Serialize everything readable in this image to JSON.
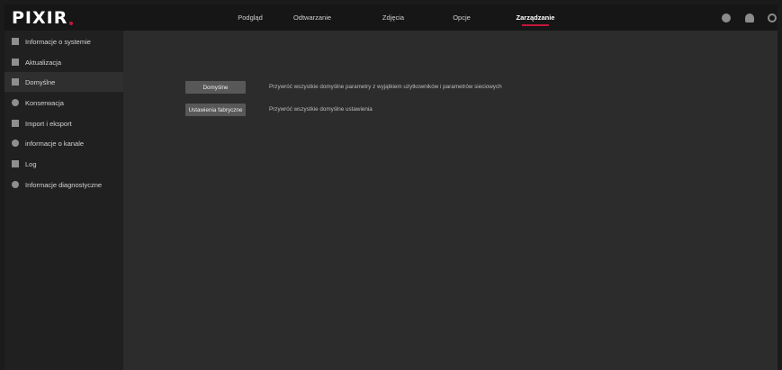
{
  "app": {
    "logo_text": "PIXIR"
  },
  "top_nav": {
    "items": [
      {
        "label": "Podgląd"
      },
      {
        "label": "Odtwarzanie"
      },
      {
        "label": "Zdjęcia"
      },
      {
        "label": "Opcje"
      },
      {
        "label": "Zarządzanie",
        "active": true
      }
    ],
    "icons": [
      "user-icon",
      "cloud-icon",
      "power-icon"
    ]
  },
  "sidebar": {
    "items": [
      {
        "label": "Informacje o systemie",
        "icon": "system-info-icon"
      },
      {
        "label": "Aktualizacja",
        "icon": "upgrade-icon"
      },
      {
        "label": "Domyślne",
        "icon": "defaults-icon",
        "active": true
      },
      {
        "label": "Konserwacja",
        "icon": "maintenance-icon"
      },
      {
        "label": "Import i eksport",
        "icon": "import-export-icon"
      },
      {
        "label": "informacje o kanale",
        "icon": "channel-info-icon"
      },
      {
        "label": "Log",
        "icon": "log-icon"
      },
      {
        "label": "Informacje diagnostyczne",
        "icon": "diagnostics-icon"
      }
    ]
  },
  "main": {
    "defaults_button": "Domyślne",
    "defaults_description": "Przywróć wszystkie domyślne parametry z wyjątkiem użytkowników i parametrów sieciowych",
    "factory_button": "Ustawienia fabryczne",
    "factory_description": "Przywróć wszystkie domyślne ustawienia"
  },
  "colors": {
    "accent": "#c3163a",
    "topbar_bg": "#161616",
    "sidebar_bg": "#202020",
    "content_bg": "#2c2c2c",
    "button_bg": "#585858"
  }
}
